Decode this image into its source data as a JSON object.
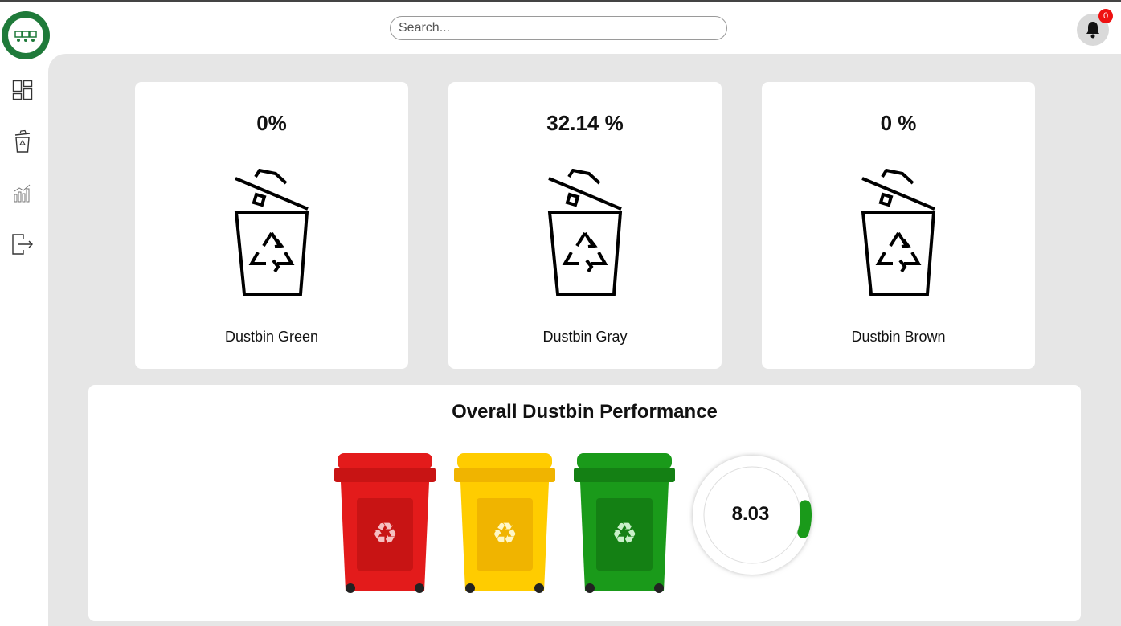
{
  "header": {
    "search_placeholder": "Search...",
    "search_value": "",
    "notification_count": "0",
    "logo_icon": "smart-waste-management-logo",
    "bell_icon": "bell-icon"
  },
  "sidebar": {
    "items": [
      {
        "name": "dashboard",
        "icon": "dashboard-icon"
      },
      {
        "name": "dustbins",
        "icon": "recycle-bin-icon"
      },
      {
        "name": "analytics",
        "icon": "bar-chart-icon"
      },
      {
        "name": "logout",
        "icon": "logout-icon"
      }
    ]
  },
  "cards": [
    {
      "percent": "0%",
      "label": "Dustbin Green",
      "fill_percent": 0
    },
    {
      "percent": "32.14 %",
      "label": "Dustbin Gray",
      "fill_percent": 32.14
    },
    {
      "percent": "0 %",
      "label": "Dustbin Brown",
      "fill_percent": 0
    }
  ],
  "performance": {
    "title": "Overall Dustbin Performance",
    "bins": [
      {
        "color": "#e31b1b",
        "name": "red-bin"
      },
      {
        "color": "#ffcc00",
        "name": "yellow-bin"
      },
      {
        "color": "#1a9a1a",
        "name": "green-bin"
      }
    ],
    "gauge": {
      "value": "8.03",
      "fraction": 0.0803,
      "color": "#1a9a1a"
    }
  },
  "colors": {
    "background": "#e6e6e6",
    "card": "#ffffff",
    "badge": "#ee1111",
    "logo": "#1f7a3a"
  }
}
